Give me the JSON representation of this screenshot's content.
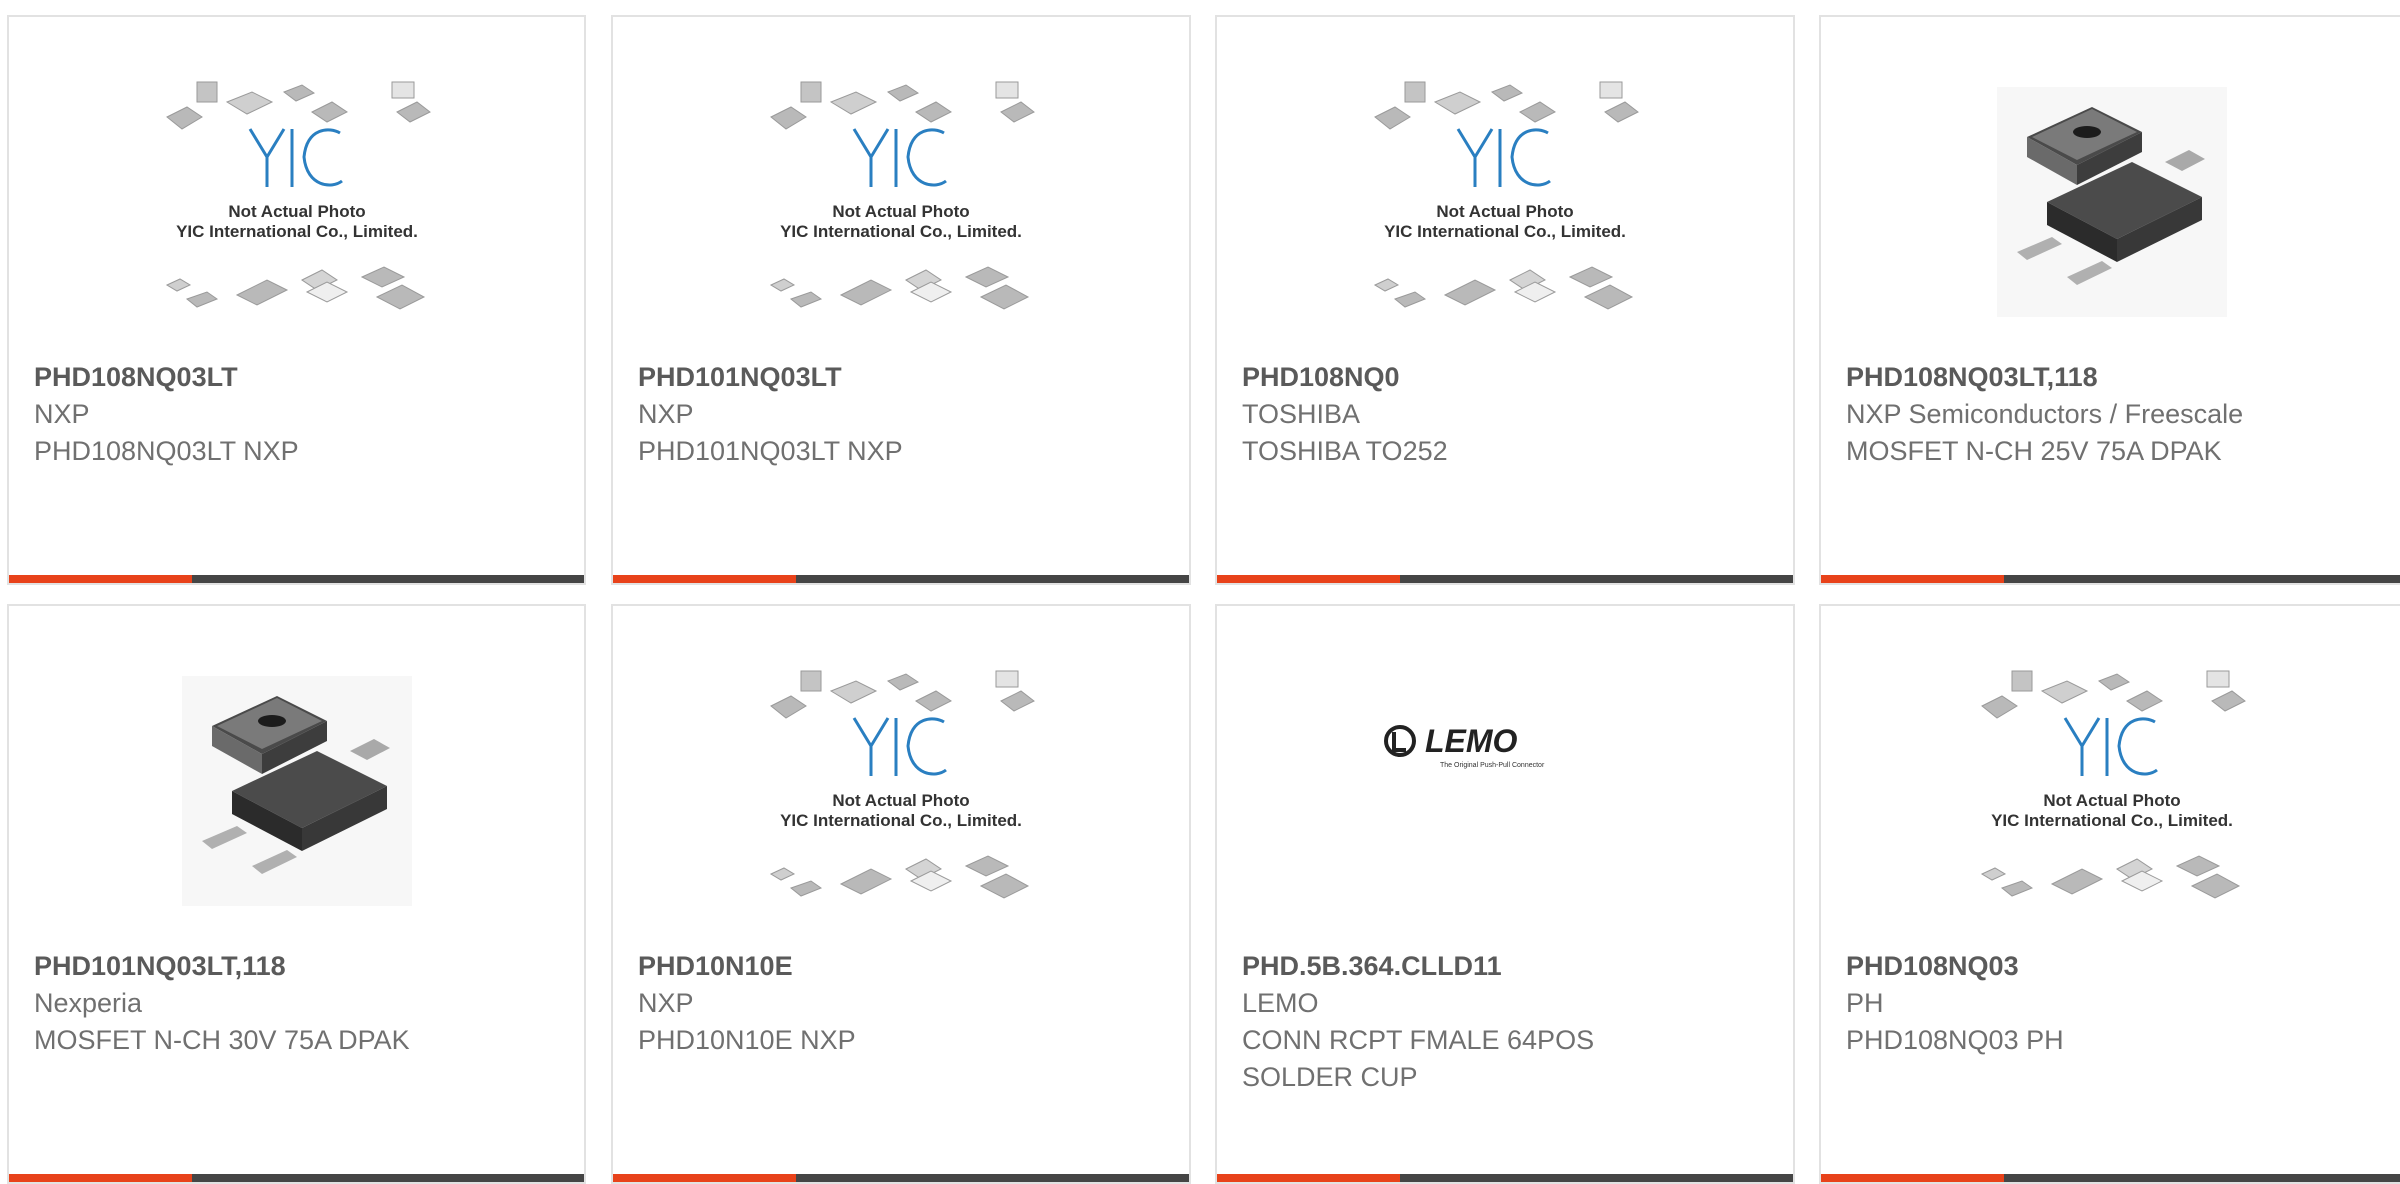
{
  "colors": {
    "accent": "#e8421a",
    "bar": "#454545",
    "border": "#e2e2e2",
    "logo": "#2a7fc1"
  },
  "placeholder": {
    "logo": "YIC",
    "caption_line1": "Not Actual Photo",
    "caption_line2": "YIC International Co., Limited."
  },
  "lemo": {
    "logo": "LEMO",
    "tagline": "The Original Push-Pull Connector"
  },
  "products": [
    {
      "part": "PHD108NQ03LT",
      "brand": "NXP",
      "desc": [
        "PHD108NQ03LT NXP"
      ],
      "image": "yic-placeholder-image"
    },
    {
      "part": "PHD101NQ03LT",
      "brand": "NXP",
      "desc": [
        "PHD101NQ03LT NXP"
      ],
      "image": "yic-placeholder-image"
    },
    {
      "part": "PHD108NQ0",
      "brand": "TOSHIBA",
      "desc": [
        "TOSHIBA TO252"
      ],
      "image": "yic-placeholder-image"
    },
    {
      "part": "PHD108NQ03LT,118",
      "brand": "NXP Semiconductors / Freescale",
      "desc": [
        "MOSFET N-CH 25V 75A DPAK"
      ],
      "image": "dpak-package-image"
    },
    {
      "part": "PHD101NQ03LT,118",
      "brand": "Nexperia",
      "desc": [
        "MOSFET N-CH 30V 75A DPAK"
      ],
      "image": "dpak-package-image"
    },
    {
      "part": "PHD10N10E",
      "brand": "NXP",
      "desc": [
        "PHD10N10E NXP"
      ],
      "image": "yic-placeholder-image"
    },
    {
      "part": "PHD.5B.364.CLLD11",
      "brand": "LEMO",
      "desc": [
        "CONN RCPT FMALE 64POS",
        "SOLDER CUP"
      ],
      "image": "lemo-logo-image"
    },
    {
      "part": "PHD108NQ03",
      "brand": "PH",
      "desc": [
        "PHD108NQ03 PH"
      ],
      "image": "yic-placeholder-image"
    }
  ]
}
